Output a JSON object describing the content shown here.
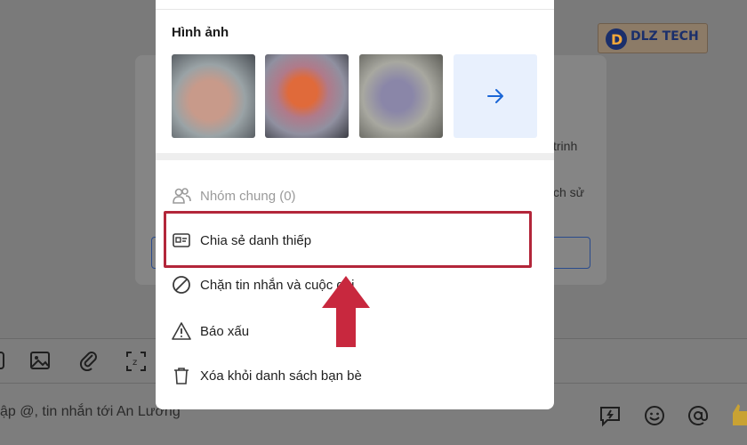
{
  "background": {
    "dialog_fragment_1": "trinh",
    "dialog_fragment_2": "ch sử",
    "composer_placeholder": "ập @, tin nhắn tới An Lương"
  },
  "logo": {
    "text": "DLZ TECH"
  },
  "panel": {
    "images_title": "Hình ảnh",
    "thumbnails": [
      "photo-1",
      "photo-2",
      "photo-3"
    ],
    "more_icon": "arrow-right-icon",
    "menu": [
      {
        "label": "Nhóm chung (0)",
        "icon": "users-icon",
        "disabled": true
      },
      {
        "label": "Chia sẻ danh thiếp",
        "icon": "contact-card-icon",
        "disabled": false
      },
      {
        "label": "Chặn tin nhắn và cuộc gọi",
        "icon": "block-icon",
        "disabled": false
      },
      {
        "label": "Báo xấu",
        "icon": "warning-icon",
        "disabled": false
      },
      {
        "label": "Xóa khỏi danh sách bạn bè",
        "icon": "trash-icon",
        "disabled": false
      }
    ]
  },
  "colors": {
    "accent": "#1a66d6",
    "highlight": "#b3263a",
    "arrow": "#c8283e"
  }
}
